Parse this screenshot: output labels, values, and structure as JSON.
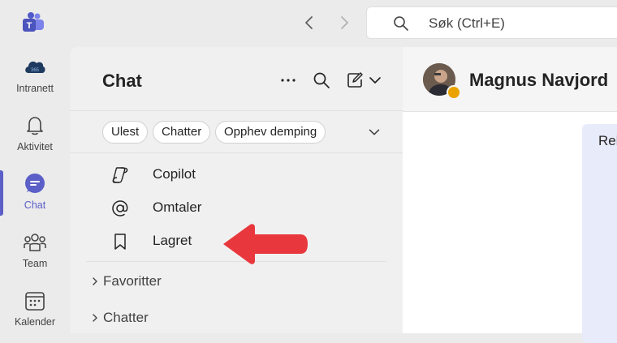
{
  "titlebar": {
    "search_placeholder": "Søk (Ctrl+E)",
    "back_icon": "chevron-left-icon",
    "forward_icon": "chevron-right-icon",
    "logo_icon": "teams-logo-icon"
  },
  "rail": {
    "items": [
      {
        "label": "Intranett",
        "icon": "intranet-icon"
      },
      {
        "label": "Aktivitet",
        "icon": "bell-icon"
      },
      {
        "label": "Chat",
        "icon": "chat-icon",
        "active": true
      },
      {
        "label": "Team",
        "icon": "team-icon"
      },
      {
        "label": "Kalender",
        "icon": "calendar-icon"
      }
    ],
    "accent": "#5b5fc7"
  },
  "panel": {
    "title": "Chat",
    "header_icons": [
      "more-options-icon",
      "search-icon",
      "new-chat-icon",
      "chevron-down-icon"
    ],
    "filters": [
      "Ulest",
      "Chatter",
      "Opphev demping"
    ],
    "quick_items": [
      {
        "label": "Copilot",
        "icon": "copilot-icon"
      },
      {
        "label": "Omtaler",
        "icon": "at-sign-icon"
      },
      {
        "label": "Lagret",
        "icon": "bookmark-icon"
      }
    ],
    "sections": [
      {
        "label": "Favoritter",
        "icon": "chevron-right-icon"
      },
      {
        "label": "Chatter",
        "icon": "chevron-right-icon"
      }
    ]
  },
  "conversation": {
    "name": "Magnus Navjord",
    "presence_color": "#eaa300",
    "message_preview": "Rel"
  },
  "annotation": {
    "arrow_color": "#e8383d",
    "arrow_icon": "red-arrow-pointer"
  }
}
